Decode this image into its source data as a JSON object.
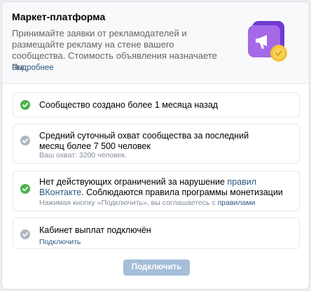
{
  "header": {
    "title": "Маркет-платформа",
    "description": "Принимайте заявки от рекламодателей и размещайте рекламу на стене вашего сообщества. Стоимость объявления назначаете вы.",
    "more_link": "Подробнее"
  },
  "requirements": [
    {
      "status": "done",
      "icon": "green-check-icon",
      "text": "Сообщество создано более 1 месяца назад"
    },
    {
      "status": "pending",
      "icon": "grey-check-icon",
      "text": "Средний суточный охват сообщества за последний месяц более 7 500 человек",
      "note": "Ваш охват: 3200 человек."
    },
    {
      "status": "done",
      "icon": "green-check-icon",
      "text_before_link": "Нет действующих ограничений за нарушение ",
      "text_link": "правил ВКонтакте",
      "text_after_link": ". Соблюдаются правила программы монетизации",
      "note_before_link": "Нажимая кнопку «Подключить», вы соглашаетесь с ",
      "note_link": "правилами"
    },
    {
      "status": "pending",
      "icon": "grey-check-icon",
      "text": "Кабинет выплат подключён",
      "action_link": "Подключить"
    }
  ],
  "connect_button": "Подключить",
  "colors": {
    "success": "#4bb34b",
    "pending": "#aeb7c2",
    "link": "#2a5885",
    "button_disabled": "#a5bed9"
  }
}
